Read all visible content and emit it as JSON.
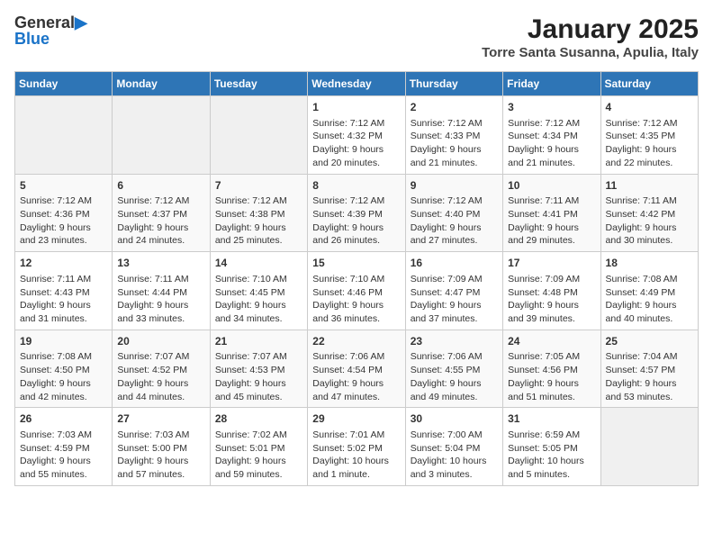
{
  "header": {
    "logo_line1": "General",
    "logo_line2": "Blue",
    "title": "January 2025",
    "subtitle": "Torre Santa Susanna, Apulia, Italy"
  },
  "days_of_week": [
    "Sunday",
    "Monday",
    "Tuesday",
    "Wednesday",
    "Thursday",
    "Friday",
    "Saturday"
  ],
  "weeks": [
    [
      {
        "day": "",
        "info": ""
      },
      {
        "day": "",
        "info": ""
      },
      {
        "day": "",
        "info": ""
      },
      {
        "day": "1",
        "info": "Sunrise: 7:12 AM\nSunset: 4:32 PM\nDaylight: 9 hours and 20 minutes."
      },
      {
        "day": "2",
        "info": "Sunrise: 7:12 AM\nSunset: 4:33 PM\nDaylight: 9 hours and 21 minutes."
      },
      {
        "day": "3",
        "info": "Sunrise: 7:12 AM\nSunset: 4:34 PM\nDaylight: 9 hours and 21 minutes."
      },
      {
        "day": "4",
        "info": "Sunrise: 7:12 AM\nSunset: 4:35 PM\nDaylight: 9 hours and 22 minutes."
      }
    ],
    [
      {
        "day": "5",
        "info": "Sunrise: 7:12 AM\nSunset: 4:36 PM\nDaylight: 9 hours and 23 minutes."
      },
      {
        "day": "6",
        "info": "Sunrise: 7:12 AM\nSunset: 4:37 PM\nDaylight: 9 hours and 24 minutes."
      },
      {
        "day": "7",
        "info": "Sunrise: 7:12 AM\nSunset: 4:38 PM\nDaylight: 9 hours and 25 minutes."
      },
      {
        "day": "8",
        "info": "Sunrise: 7:12 AM\nSunset: 4:39 PM\nDaylight: 9 hours and 26 minutes."
      },
      {
        "day": "9",
        "info": "Sunrise: 7:12 AM\nSunset: 4:40 PM\nDaylight: 9 hours and 27 minutes."
      },
      {
        "day": "10",
        "info": "Sunrise: 7:11 AM\nSunset: 4:41 PM\nDaylight: 9 hours and 29 minutes."
      },
      {
        "day": "11",
        "info": "Sunrise: 7:11 AM\nSunset: 4:42 PM\nDaylight: 9 hours and 30 minutes."
      }
    ],
    [
      {
        "day": "12",
        "info": "Sunrise: 7:11 AM\nSunset: 4:43 PM\nDaylight: 9 hours and 31 minutes."
      },
      {
        "day": "13",
        "info": "Sunrise: 7:11 AM\nSunset: 4:44 PM\nDaylight: 9 hours and 33 minutes."
      },
      {
        "day": "14",
        "info": "Sunrise: 7:10 AM\nSunset: 4:45 PM\nDaylight: 9 hours and 34 minutes."
      },
      {
        "day": "15",
        "info": "Sunrise: 7:10 AM\nSunset: 4:46 PM\nDaylight: 9 hours and 36 minutes."
      },
      {
        "day": "16",
        "info": "Sunrise: 7:09 AM\nSunset: 4:47 PM\nDaylight: 9 hours and 37 minutes."
      },
      {
        "day": "17",
        "info": "Sunrise: 7:09 AM\nSunset: 4:48 PM\nDaylight: 9 hours and 39 minutes."
      },
      {
        "day": "18",
        "info": "Sunrise: 7:08 AM\nSunset: 4:49 PM\nDaylight: 9 hours and 40 minutes."
      }
    ],
    [
      {
        "day": "19",
        "info": "Sunrise: 7:08 AM\nSunset: 4:50 PM\nDaylight: 9 hours and 42 minutes."
      },
      {
        "day": "20",
        "info": "Sunrise: 7:07 AM\nSunset: 4:52 PM\nDaylight: 9 hours and 44 minutes."
      },
      {
        "day": "21",
        "info": "Sunrise: 7:07 AM\nSunset: 4:53 PM\nDaylight: 9 hours and 45 minutes."
      },
      {
        "day": "22",
        "info": "Sunrise: 7:06 AM\nSunset: 4:54 PM\nDaylight: 9 hours and 47 minutes."
      },
      {
        "day": "23",
        "info": "Sunrise: 7:06 AM\nSunset: 4:55 PM\nDaylight: 9 hours and 49 minutes."
      },
      {
        "day": "24",
        "info": "Sunrise: 7:05 AM\nSunset: 4:56 PM\nDaylight: 9 hours and 51 minutes."
      },
      {
        "day": "25",
        "info": "Sunrise: 7:04 AM\nSunset: 4:57 PM\nDaylight: 9 hours and 53 minutes."
      }
    ],
    [
      {
        "day": "26",
        "info": "Sunrise: 7:03 AM\nSunset: 4:59 PM\nDaylight: 9 hours and 55 minutes."
      },
      {
        "day": "27",
        "info": "Sunrise: 7:03 AM\nSunset: 5:00 PM\nDaylight: 9 hours and 57 minutes."
      },
      {
        "day": "28",
        "info": "Sunrise: 7:02 AM\nSunset: 5:01 PM\nDaylight: 9 hours and 59 minutes."
      },
      {
        "day": "29",
        "info": "Sunrise: 7:01 AM\nSunset: 5:02 PM\nDaylight: 10 hours and 1 minute."
      },
      {
        "day": "30",
        "info": "Sunrise: 7:00 AM\nSunset: 5:04 PM\nDaylight: 10 hours and 3 minutes."
      },
      {
        "day": "31",
        "info": "Sunrise: 6:59 AM\nSunset: 5:05 PM\nDaylight: 10 hours and 5 minutes."
      },
      {
        "day": "",
        "info": ""
      }
    ]
  ]
}
